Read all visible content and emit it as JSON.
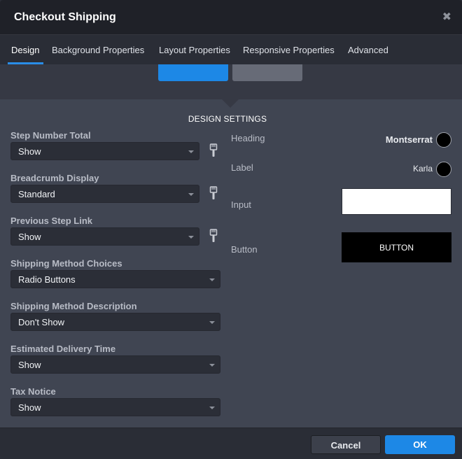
{
  "window": {
    "title": "Checkout Shipping",
    "close_glyph": "✖"
  },
  "tabs": [
    {
      "label": "Design",
      "active": true
    },
    {
      "label": "Background Properties",
      "active": false
    },
    {
      "label": "Layout Properties",
      "active": false
    },
    {
      "label": "Responsive Properties",
      "active": false
    },
    {
      "label": "Advanced",
      "active": false
    }
  ],
  "section_title": "DESIGN SETTINGS",
  "fields": [
    {
      "label": "Step Number Total",
      "value": "Show"
    },
    {
      "label": "Breadcrumb Display",
      "value": "Standard"
    },
    {
      "label": "Previous Step Link",
      "value": "Show"
    },
    {
      "label": "Shipping Method Choices",
      "value": "Radio Buttons"
    },
    {
      "label": "Shipping Method Description",
      "value": "Don't Show"
    },
    {
      "label": "Estimated Delivery Time",
      "value": "Show"
    },
    {
      "label": "Tax Notice",
      "value": "Show"
    }
  ],
  "styles": {
    "heading": {
      "label": "Heading",
      "font": "Montserrat",
      "color": "#000000"
    },
    "label": {
      "label": "Label",
      "font": "Karla",
      "color": "#000000"
    },
    "input": {
      "label": "Input",
      "background": "#ffffff"
    },
    "button": {
      "label": "Button",
      "text": "BUTTON",
      "background": "#000000"
    }
  },
  "footer": {
    "cancel_label": "Cancel",
    "ok_label": "OK"
  },
  "colors": {
    "accent": "#1d88e6",
    "panel": "#404552",
    "dark": "#2a2d36"
  }
}
